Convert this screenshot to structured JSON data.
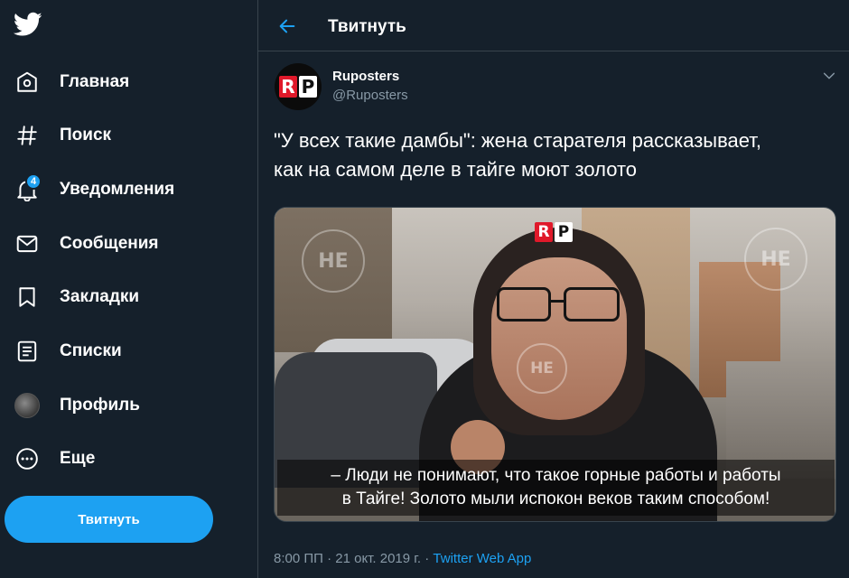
{
  "sidebar": {
    "items": [
      {
        "id": "home",
        "label": "Главная",
        "icon": "home-icon"
      },
      {
        "id": "search",
        "label": "Поиск",
        "icon": "hashtag-icon"
      },
      {
        "id": "notifications",
        "label": "Уведомления",
        "icon": "bell-icon",
        "badge": "4"
      },
      {
        "id": "messages",
        "label": "Сообщения",
        "icon": "envelope-icon"
      },
      {
        "id": "bookmarks",
        "label": "Закладки",
        "icon": "bookmark-icon"
      },
      {
        "id": "lists",
        "label": "Списки",
        "icon": "list-icon"
      },
      {
        "id": "profile",
        "label": "Профиль",
        "icon": "avatar"
      },
      {
        "id": "more",
        "label": "Еще",
        "icon": "more-circle-icon"
      }
    ],
    "tweet_button": "Твитнуть"
  },
  "header": {
    "title": "Твитнуть",
    "back_icon": "back-arrow-icon"
  },
  "tweet": {
    "author_name": "Ruposters",
    "author_handle": "@Ruposters",
    "avatar_text_r": "R",
    "avatar_text_p": "P",
    "text_line1": "\"У всех такие дамбы\": жена старателя рассказывает,",
    "text_line2": "как на самом деле в тайге моют золото",
    "media": {
      "subtitle_line1": "– Люди не понимают, что такое горные работы и работы",
      "subtitle_line2": "в Тайге! Золото мыли испокон веков таким способом!",
      "watermark": "НЕ"
    },
    "timestamp": "8:00 ПП · 21 окт. 2019 г. · ",
    "source": "Twitter Web App"
  },
  "colors": {
    "background": "#15202b",
    "accent": "#1da1f2",
    "secondary_text": "#8899a6",
    "border": "#38444d"
  }
}
